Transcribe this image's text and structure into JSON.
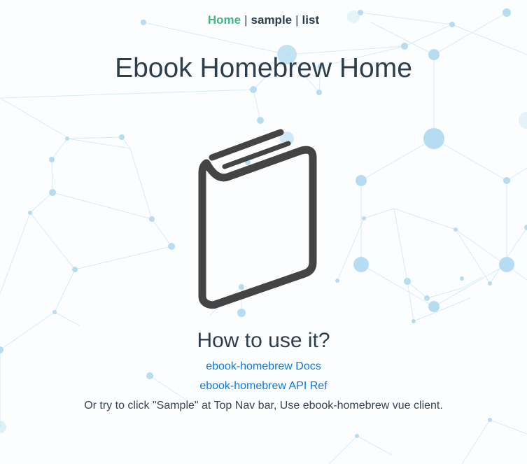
{
  "nav": {
    "home": "Home",
    "sample": "sample",
    "list": "list",
    "separator": "|"
  },
  "page_title": "Ebook Homebrew Home",
  "book_icon": "book-icon",
  "section_title": "How to use it?",
  "links": {
    "docs": "ebook-homebrew Docs",
    "api_ref": "ebook-homebrew API Ref"
  },
  "hint": "Or try to click \"Sample\" at Top Nav bar, Use ebook-homebrew vue client.",
  "colors": {
    "nav_active": "#42b983",
    "link": "#0a79e0",
    "text": "#2c3e50",
    "icon": "#444444",
    "network": "#aed8ee"
  }
}
